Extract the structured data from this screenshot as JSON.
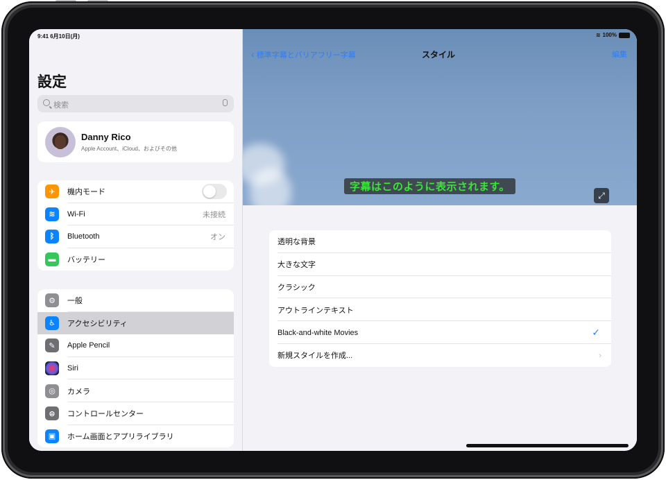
{
  "status": {
    "time_date": "9:41  6月10日(月)",
    "battery": "100%"
  },
  "sidebar": {
    "title": "設定",
    "search_placeholder": "検索",
    "profile": {
      "name": "Danny Rico",
      "subtitle": "Apple Account、iCloud、およびその他"
    },
    "group1": [
      {
        "label": "機内モード",
        "icon": "airplane-icon",
        "color": "#ff9500",
        "value": "",
        "toggle": true
      },
      {
        "label": "Wi-Fi",
        "icon": "wifi-icon",
        "color": "#0a84ff",
        "value": "未接続"
      },
      {
        "label": "Bluetooth",
        "icon": "bluetooth-icon",
        "color": "#0a84ff",
        "value": "オン"
      },
      {
        "label": "バッテリー",
        "icon": "battery-icon",
        "color": "#34c759",
        "value": ""
      }
    ],
    "group2": [
      {
        "label": "一般",
        "icon": "gear-icon",
        "color": "#8e8e93"
      },
      {
        "label": "アクセシビリティ",
        "icon": "accessibility-icon",
        "color": "#0a84ff",
        "selected": true
      },
      {
        "label": "Apple Pencil",
        "icon": "pencil-icon",
        "color": "#6e6e73"
      },
      {
        "label": "Siri",
        "icon": "siri-icon",
        "color": "#111111"
      },
      {
        "label": "カメラ",
        "icon": "camera-icon",
        "color": "#8e8e93"
      },
      {
        "label": "コントロールセンター",
        "icon": "control-center-icon",
        "color": "#6e6e73"
      },
      {
        "label": "ホーム画面とアプリライブラリ",
        "icon": "home-screen-icon",
        "color": "#0a84ff"
      }
    ]
  },
  "detail": {
    "back_label": "標準字幕とバリアフリー字幕",
    "title": "スタイル",
    "edit_label": "編集",
    "caption_preview": "字幕はこのように表示されます。",
    "styles": [
      {
        "label": "透明な背景"
      },
      {
        "label": "大きな文字"
      },
      {
        "label": "クラシック"
      },
      {
        "label": "アウトラインテキスト"
      },
      {
        "label": "Black-and-white Movies",
        "checked": true
      },
      {
        "label": "新規スタイルを作成...",
        "chevron": true
      }
    ]
  }
}
